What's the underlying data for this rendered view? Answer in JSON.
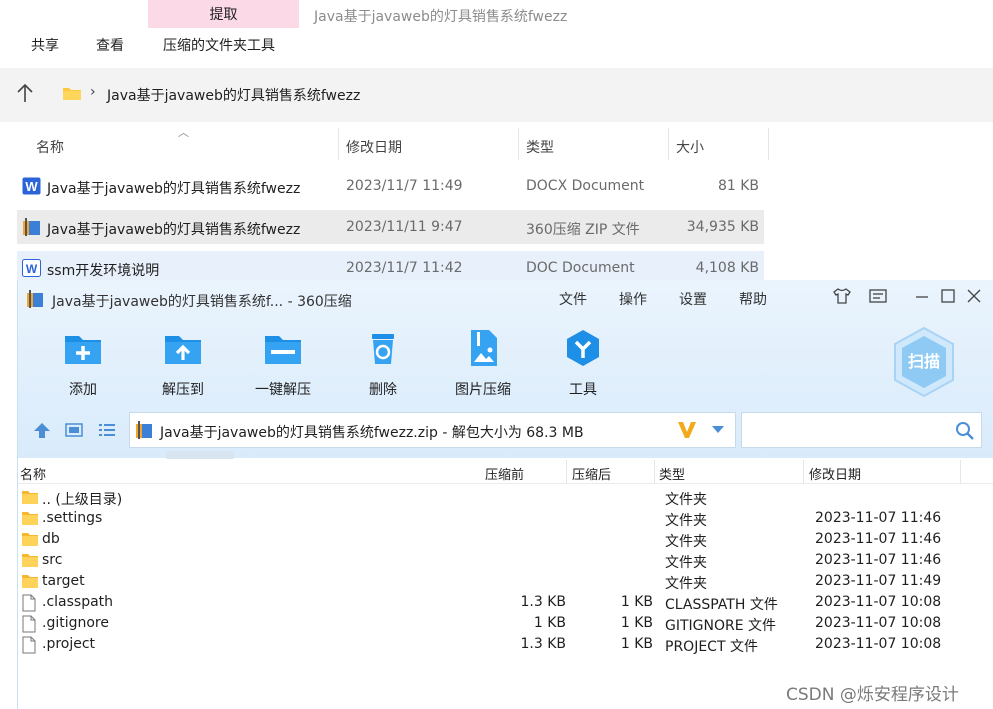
{
  "explorer": {
    "ribbon": {
      "extract_tab": "提取",
      "window_title": "Java基于javaweb的灯具销售系统fwezz",
      "menu": [
        "共享",
        "查看",
        "压缩的文件夹工具"
      ]
    },
    "address": {
      "path": "Java基于javaweb的灯具销售系统fwezz"
    },
    "columns": [
      "名称",
      "修改日期",
      "类型",
      "大小"
    ],
    "files": [
      {
        "name": "Java基于javaweb的灯具销售系统fwezz",
        "date": "2023/11/7 11:49",
        "type": "DOCX Document",
        "size": "81 KB",
        "icon": "word-docx-icon"
      },
      {
        "name": "Java基于javaweb的灯具销售系统fwezz",
        "date": "2023/11/11 9:47",
        "type": "360压缩 ZIP 文件",
        "size": "34,935 KB",
        "icon": "zip-archive-icon"
      },
      {
        "name": "ssm开发环境说明",
        "date": "2023/11/7 11:42",
        "type": "DOC Document",
        "size": "4,108 KB",
        "icon": "word-doc-icon"
      }
    ]
  },
  "zip": {
    "title": "Java基于javaweb的灯具销售系统f... - 360压缩",
    "menu": [
      "文件",
      "操作",
      "设置",
      "帮助"
    ],
    "toolbar": [
      {
        "label": "添加",
        "icon": "add-folder-icon"
      },
      {
        "label": "解压到",
        "icon": "extract-to-icon"
      },
      {
        "label": "一键解压",
        "icon": "one-click-extract-icon"
      },
      {
        "label": "删除",
        "icon": "recycle-bin-icon"
      },
      {
        "label": "图片压缩",
        "icon": "image-compress-icon"
      },
      {
        "label": "工具",
        "icon": "tools-icon"
      }
    ],
    "scan_label": "扫描",
    "path": "Java基于javaweb的灯具销售系统fwezz.zip - 解包大小为 68.3 MB",
    "search_placeholder": "",
    "columns": [
      "名称",
      "压缩前",
      "压缩后",
      "类型",
      "修改日期"
    ],
    "entries": [
      {
        "name": ".. (上级目录)",
        "before": "",
        "after": "",
        "type": "文件夹",
        "date": "",
        "kind": "folder"
      },
      {
        "name": ".settings",
        "before": "",
        "after": "",
        "type": "文件夹",
        "date": "2023-11-07 11:46",
        "kind": "folder"
      },
      {
        "name": "db",
        "before": "",
        "after": "",
        "type": "文件夹",
        "date": "2023-11-07 11:46",
        "kind": "folder"
      },
      {
        "name": "src",
        "before": "",
        "after": "",
        "type": "文件夹",
        "date": "2023-11-07 11:46",
        "kind": "folder"
      },
      {
        "name": "target",
        "before": "",
        "after": "",
        "type": "文件夹",
        "date": "2023-11-07 11:49",
        "kind": "folder"
      },
      {
        "name": ".classpath",
        "before": "1.3 KB",
        "after": "1 KB",
        "type": "CLASSPATH 文件",
        "date": "2023-11-07 10:08",
        "kind": "file"
      },
      {
        "name": ".gitignore",
        "before": "1 KB",
        "after": "1 KB",
        "type": "GITIGNORE 文件",
        "date": "2023-11-07 10:08",
        "kind": "file"
      },
      {
        "name": ".project",
        "before": "1.3 KB",
        "after": "1 KB",
        "type": "PROJECT 文件",
        "date": "2023-11-07 10:08",
        "kind": "file"
      }
    ]
  },
  "watermark": "CSDN @烁安程序设计",
  "colors": {
    "accent": "#1e8fe6",
    "extract_tab": "#fbd9e7",
    "folder": "#ffc83d"
  }
}
